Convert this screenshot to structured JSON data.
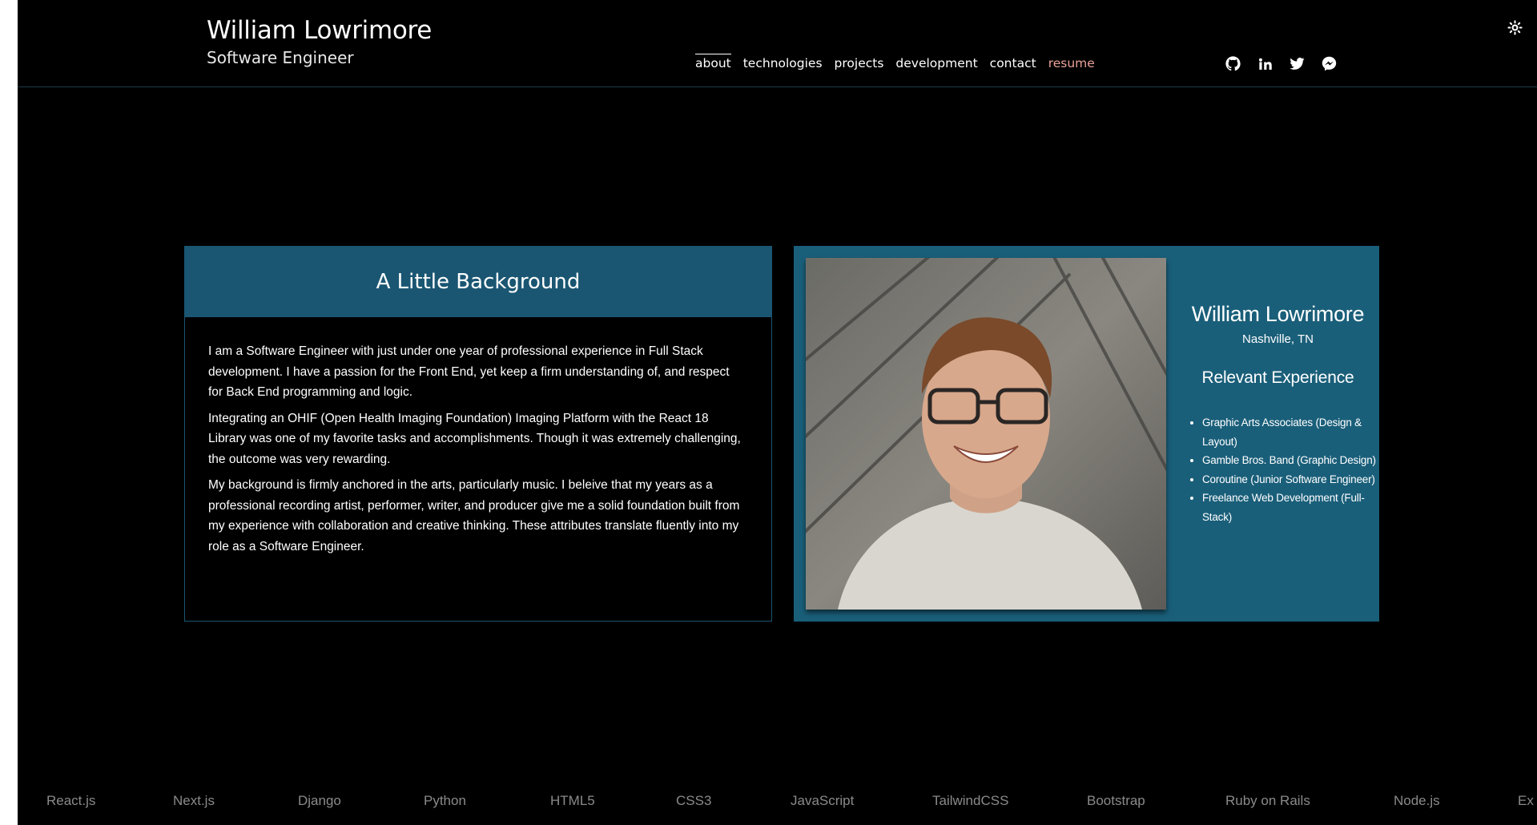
{
  "header": {
    "name": "William Lowrimore",
    "role": "Software Engineer"
  },
  "nav": {
    "items": [
      "about",
      "technologies",
      "projects",
      "development",
      "contact",
      "resume"
    ],
    "active": "about"
  },
  "socials": [
    "github-icon",
    "linkedin-icon",
    "twitter-icon",
    "messenger-icon"
  ],
  "theme_toggle_icon": "sun-icon",
  "background": {
    "title": "A Little Background",
    "paragraphs": [
      "I am a Software Engineer with just under one year of professional experience in Full Stack development. I have a passion for the Front End, yet keep a firm understanding of, and respect for Back End programming and logic.",
      "Integrating an OHIF (Open Health Imaging Foundation) Imaging Platform with the React 18 Library was one of my favorite tasks and accomplishments. Though it was extremely challenging, the outcome was very rewarding.",
      "My background is firmly anchored in the arts, particularly music. I beleive that my years as a professional recording artist, performer, writer, and producer give me a solid foundation built from my experience with collaboration and creative thinking. These attributes translate fluently into my role as a Software Engineer."
    ]
  },
  "profile": {
    "name": "William Lowrimore",
    "location": "Nashville, TN",
    "experience_title": "Relevant Experience",
    "experience": [
      "Graphic Arts Associates (Design & Layout)",
      "Gamble Bros. Band (Graphic Design)",
      "Coroutine (Junior Software Engineer)",
      "Freelance Web Development (Full-Stack)"
    ]
  },
  "technologies": [
    "React.js",
    "Next.js",
    "Django",
    "Python",
    "HTML5",
    "CSS3",
    "JavaScript",
    "TailwindCSS",
    "Bootstrap",
    "Ruby on Rails",
    "Node.js",
    "Ex"
  ],
  "colors": {
    "background": "#000000",
    "accent": "#1a5f7a",
    "resume_link": "#e9a198",
    "tech_text": "#8a8a8a"
  }
}
